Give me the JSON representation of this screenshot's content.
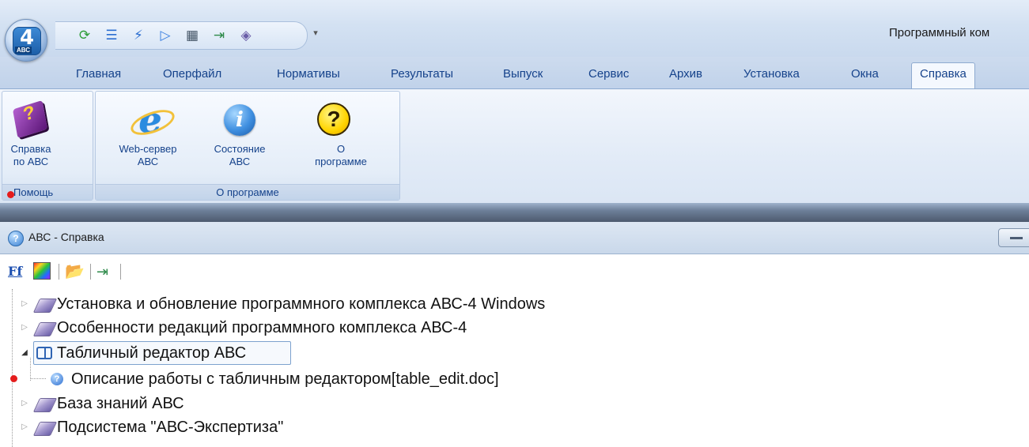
{
  "window": {
    "title": "Программный ком"
  },
  "app_logo": {
    "big": "4",
    "small": "АВС"
  },
  "quick_access": {
    "icons": [
      "refresh-icon",
      "tree-view-icon",
      "chart-icon",
      "play-icon",
      "table-icon",
      "export-icon",
      "filter-icon"
    ],
    "dropdown": "▾"
  },
  "ribbon_tabs": [
    {
      "label": "Главная"
    },
    {
      "label": "Оперфайл"
    },
    {
      "label": "Нормативы"
    },
    {
      "label": "Результаты"
    },
    {
      "label": "Выпуск"
    },
    {
      "label": "Сервис"
    },
    {
      "label": "Архив"
    },
    {
      "label": "Установка"
    },
    {
      "label": "Окна"
    },
    {
      "label": "Справка",
      "active": true
    }
  ],
  "ribbon_groups": {
    "help": {
      "label": "Помощь",
      "buttons": [
        {
          "line1": "Справка",
          "line2": "по АВС",
          "icon": "help-book-icon"
        }
      ]
    },
    "about": {
      "label": "О программе",
      "buttons": [
        {
          "line1": "Web-сервер",
          "line2": "АВС",
          "icon": "internet-explorer-icon"
        },
        {
          "line1": "Состояние",
          "line2": "АВС",
          "icon": "info-icon"
        },
        {
          "line1": "О",
          "line2": "программе",
          "icon": "question-icon"
        }
      ]
    }
  },
  "help_window": {
    "title": "АВС - Справка",
    "toolbar": {
      "font_label": "Ff"
    },
    "tree": [
      {
        "label": "Установка и обновление программного комплекса АВС-4 Windows",
        "expanded": false
      },
      {
        "label": "Особенности редакций программного комплекса АВС-4",
        "expanded": false
      },
      {
        "label": "Табличный редактор АВС",
        "expanded": true,
        "selected": true
      },
      {
        "label": "Описание работы с табличным редактором[table_edit.doc]",
        "child": true
      },
      {
        "label": "База знаний АВС",
        "expanded": false
      },
      {
        "label": "Подсистема \"АВС-Экспертиза\"",
        "expanded": false
      }
    ]
  },
  "colors": {
    "accent_blue": "#15428b",
    "marker_red": "#e51c1c"
  }
}
